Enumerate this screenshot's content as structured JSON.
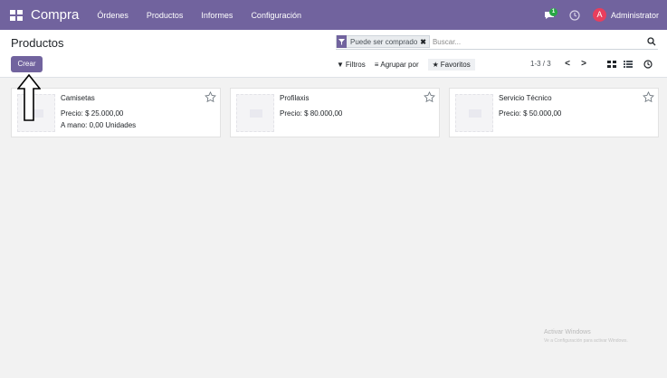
{
  "navbar": {
    "brand": "Compra",
    "menu": [
      "Órdenes",
      "Productos",
      "Informes",
      "Configuración"
    ],
    "chat_badge": "1",
    "user_initial": "A",
    "user_name": "Administrator",
    "color": "#71639e"
  },
  "control_panel": {
    "title": "Productos",
    "create_label": "Crear",
    "facet_label": "Puede ser comprado",
    "search_placeholder": "Buscar...",
    "filters_label": "Filtros",
    "group_label": "Agrupar por",
    "favorites_label": "Favoritos",
    "pager": "1-3 / 3",
    "prev": "<",
    "next": ">"
  },
  "products": [
    {
      "name": "Camisetas",
      "price": "Precio: $ 25.000,00",
      "on_hand": "A mano: 0,00 Unidades"
    },
    {
      "name": "Profilaxis",
      "price": "Precio: $ 80.000,00",
      "on_hand": ""
    },
    {
      "name": "Servicio Técnico",
      "price": "Precio: $ 50.000,00",
      "on_hand": ""
    }
  ],
  "watermark": {
    "title": "Activar Windows",
    "subtitle": "Ve a Configuración para activar Windows."
  }
}
